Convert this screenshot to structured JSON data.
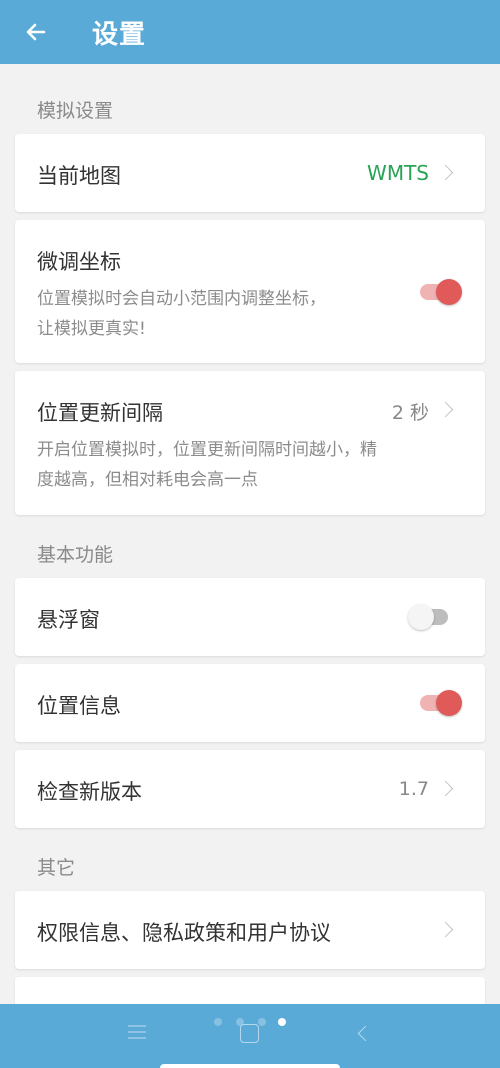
{
  "appbar": {
    "title": "设置"
  },
  "sections": {
    "simulation": "模拟设置",
    "basic": "基本功能",
    "other": "其它"
  },
  "items": {
    "current_map": {
      "title": "当前地图",
      "value": "WMTS"
    },
    "fine_tune": {
      "title": "微调坐标",
      "desc_line1": "位置模拟时会自动小范围内调整坐标，",
      "desc_line2": "让模拟更真实!",
      "enabled": true
    },
    "update_interval": {
      "title": "位置更新间隔",
      "value": "2 秒",
      "desc_line1": "开启位置模拟时，位置更新间隔时间越小，精",
      "desc_line2": "度越高，但相对耗电会高一点"
    },
    "floating_window": {
      "title": "悬浮窗",
      "enabled": false
    },
    "location_info": {
      "title": "位置信息",
      "enabled": true
    },
    "check_update": {
      "title": "检查新版本",
      "value": "1.7"
    },
    "privacy": {
      "title": "权限信息、隐私政策和用户协议"
    }
  },
  "colors": {
    "primary": "#5aaad8",
    "switch_on": "#e05a5a",
    "value_green": "#2aa356"
  },
  "navbar": {
    "icons": [
      "menu-icon",
      "home-icon",
      "back-icon"
    ],
    "page_dots": 4,
    "active_dot": 4
  }
}
